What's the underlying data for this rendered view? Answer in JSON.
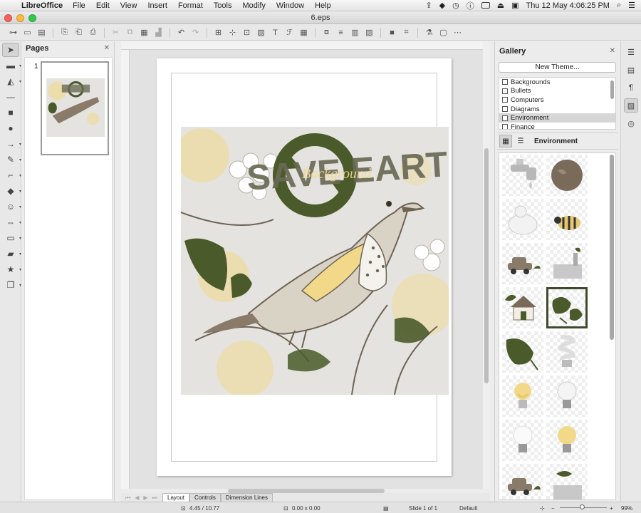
{
  "menubar": {
    "app_name": "LibreOffice",
    "items": [
      "File",
      "Edit",
      "View",
      "Insert",
      "Format",
      "Tools",
      "Modify",
      "Window",
      "Help"
    ],
    "clock": "Thu 12 May  4:06:25 PM"
  },
  "window": {
    "title": "6.eps"
  },
  "pages_panel": {
    "title": "Pages",
    "page_number": "1"
  },
  "artwork": {
    "heading": "SAVE EARTH",
    "script_text": "Background"
  },
  "gallery": {
    "title": "Gallery",
    "new_theme_label": "New Theme...",
    "themes": [
      "Backgrounds",
      "Bullets",
      "Computers",
      "Diagrams",
      "Environment",
      "Finance"
    ],
    "selected_theme": "Environment",
    "view_title": "Environment",
    "items": [
      "tap",
      "globe",
      "polar-bear",
      "bee",
      "car",
      "factory",
      "house-leaf",
      "leaves",
      "leaf",
      "cfl-bulb",
      "bulb-yellow",
      "bulb-clear",
      "bulb-white",
      "bulb-idea",
      "car-small",
      "factory-small"
    ],
    "selected_item": "leaves"
  },
  "tabs": [
    "Layout",
    "Controls",
    "Dimension Lines"
  ],
  "status": {
    "position": "4.45 / 10.77",
    "size": "0.00 x 0.00",
    "slide": "Slide 1 of 1",
    "layout": "Default",
    "zoom": "99%"
  },
  "colors": {
    "leaf_green": "#4a5a2a",
    "accent_yellow": "#f2d98a",
    "bird_brown": "#7a6a5a"
  }
}
